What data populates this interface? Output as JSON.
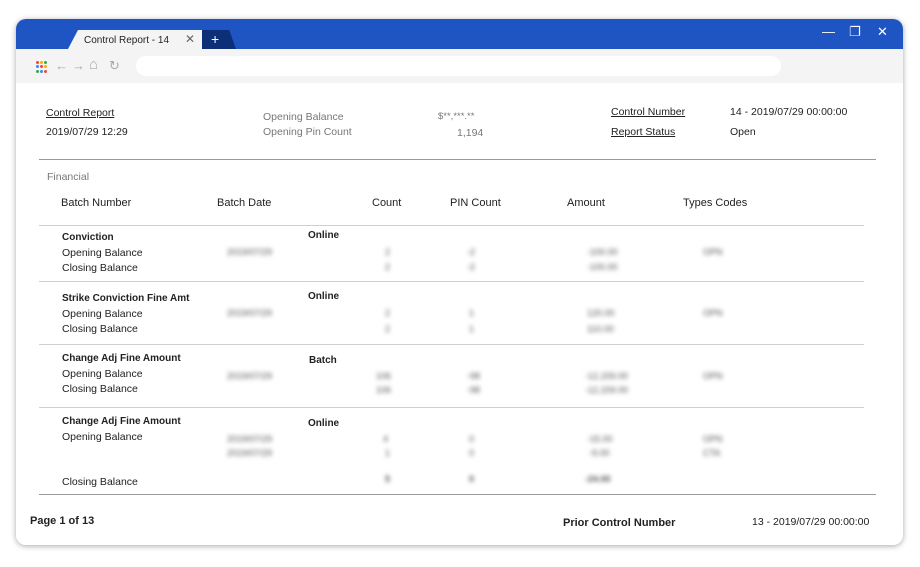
{
  "window": {
    "tab_title": "Control Report - 14",
    "tab_close": "✕",
    "new_tab": "+",
    "controls": {
      "minimize": "—",
      "restore": "❐",
      "close": "✕"
    }
  },
  "toolbar": {
    "icons": [
      "apps-icon",
      "back-icon",
      "forward-icon",
      "home-icon",
      "refresh-icon"
    ],
    "back": "←",
    "forward": "→",
    "home": "⌂",
    "refresh": "↻",
    "address": ""
  },
  "header": {
    "control_report_label": "Control Report",
    "control_report_date": "2019/07/29 12:29",
    "opening_balance_label": "Opening Balance",
    "opening_balance_value": "$**,***.**",
    "opening_pin_count_label": "Opening Pin Count",
    "opening_pin_count_value": "1,194",
    "control_number_label": "Control Number",
    "control_number_value": "14 - 2019/07/29 00:00:00",
    "report_status_label": "Report Status",
    "report_status_value": "Open"
  },
  "financial": {
    "section_label": "Financial",
    "columns": [
      "Batch Number",
      "Batch Date",
      "Count",
      "PIN Count",
      "Amount",
      "Types Codes"
    ],
    "groups": [
      {
        "name": "Conviction",
        "type": "Online",
        "rows": [
          {
            "label": "Opening Balance",
            "date": "2019/07/29",
            "count": "2",
            "pin": "-2",
            "amount": "-100.00",
            "code": "OPN"
          },
          {
            "label": "Closing Balance",
            "date": "",
            "count": "2",
            "pin": "-2",
            "amount": "-100.00",
            "code": ""
          }
        ]
      },
      {
        "name": "Strike Conviction Fine Amt",
        "type": "Online",
        "rows": [
          {
            "label": "Opening Balance",
            "date": "2019/07/29",
            "count": "2",
            "pin": "1",
            "amount": "120.00",
            "code": "OPN"
          },
          {
            "label": "Closing Balance",
            "date": "",
            "count": "2",
            "pin": "1",
            "amount": "110.00",
            "code": ""
          }
        ]
      },
      {
        "name": "Change Adj Fine Amount",
        "type": "Batch",
        "rows": [
          {
            "label": "Opening Balance",
            "date": "2019/07/29",
            "count": "106",
            "pin": "-98",
            "amount": "-12,159.00",
            "code": "OPN"
          },
          {
            "label": "Closing Balance",
            "date": "",
            "count": "106",
            "pin": "-98",
            "amount": "-12,159.00",
            "code": ""
          }
        ]
      },
      {
        "name": "Change Adj Fine Amount",
        "type": "Online",
        "rows": [
          {
            "label": "Opening Balance",
            "date": "2019/07/29",
            "count": "4",
            "pin": "0",
            "amount": "-15.00",
            "code": "OPN"
          },
          {
            "label": "",
            "date": "2019/07/29",
            "count": "1",
            "pin": "0",
            "amount": "-9.00",
            "code": "CTA"
          },
          {
            "label": "Closing Balance",
            "date": "",
            "count": "5",
            "pin": "0",
            "amount": "-24.00",
            "code": ""
          }
        ]
      }
    ]
  },
  "footer": {
    "page": "Page 1 of 13",
    "prior_control_label": "Prior Control Number",
    "prior_control_value": "13 - 2019/07/29 00:00:00"
  },
  "colors": {
    "titlebar": "#1f55c2",
    "new_tab": "#0c2f77"
  }
}
